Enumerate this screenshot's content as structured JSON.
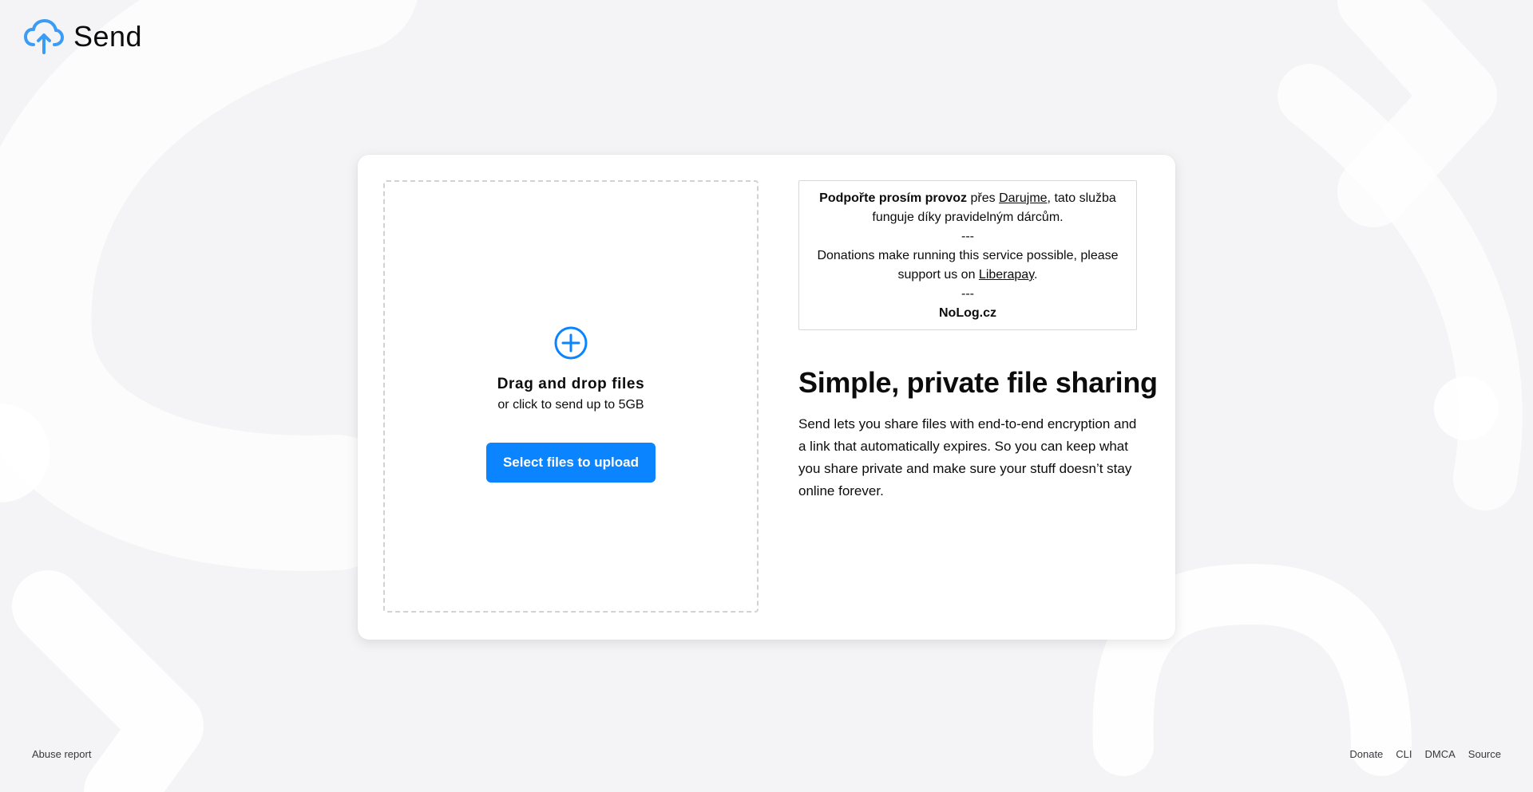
{
  "header": {
    "logo_icon": "cloud-upload-icon",
    "app_name": "Send",
    "accent_color": "#0a84ff"
  },
  "dropzone": {
    "icon": "plus-circle-icon",
    "title": "Drag and drop files",
    "subtitle": "or click to send up to 5GB",
    "button_label": "Select files to upload"
  },
  "donation": {
    "cz_bold": "Podpořte prosím provoz",
    "cz_via": " přes ",
    "cz_link": "Darujme",
    "cz_rest": ", tato služba funguje díky pravidelným dárcům.",
    "separator1": "---",
    "en_text": "Donations make running this service possible, please support us on ",
    "en_link": "Liberapay",
    "en_end": ".",
    "separator2": "---",
    "brand": "NoLog.cz"
  },
  "intro": {
    "headline": "Simple, private file sharing",
    "description": "Send lets you share files with end-to-end encryption and a link that automatically expires. So you can keep what you share private and make sure your stuff doesn’t stay online forever."
  },
  "footer": {
    "abuse_report": "Abuse report",
    "links": [
      "Donate",
      "CLI",
      "DMCA",
      "Source"
    ]
  }
}
